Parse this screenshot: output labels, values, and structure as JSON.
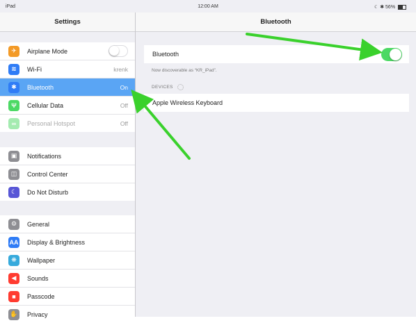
{
  "status_bar": {
    "device": "iPad",
    "time": "12:00 AM",
    "battery": "56%"
  },
  "master": {
    "title": "Settings",
    "group1": [
      {
        "label": "Airplane Mode",
        "icon": "airplane-icon",
        "color": "#f39a27",
        "control": "toggle-off"
      },
      {
        "label": "Wi-Fi",
        "icon": "wifi-icon",
        "color": "#2f7cf6",
        "value": "krenk"
      },
      {
        "label": "Bluetooth",
        "icon": "bluetooth-icon",
        "color": "#2f7cf6",
        "value": "On",
        "selected": true
      },
      {
        "label": "Cellular Data",
        "icon": "cellular-icon",
        "color": "#4cd964",
        "value": "Off"
      },
      {
        "label": "Personal Hotspot",
        "icon": "hotspot-icon",
        "color": "#4cd964",
        "value": "Off",
        "disabled": true
      }
    ],
    "group2": [
      {
        "label": "Notifications",
        "icon": "notifications-icon",
        "color": "#8e8e93"
      },
      {
        "label": "Control Center",
        "icon": "control-center-icon",
        "color": "#8e8e93"
      },
      {
        "label": "Do Not Disturb",
        "icon": "moon-icon",
        "color": "#5856d6"
      }
    ],
    "group3": [
      {
        "label": "General",
        "icon": "gear-icon",
        "color": "#8e8e93"
      },
      {
        "label": "Display & Brightness",
        "icon": "display-icon",
        "color": "#2f7cf6"
      },
      {
        "label": "Wallpaper",
        "icon": "wallpaper-icon",
        "color": "#36aadc"
      },
      {
        "label": "Sounds",
        "icon": "sound-icon",
        "color": "#ff3b30"
      },
      {
        "label": "Passcode",
        "icon": "lock-icon",
        "color": "#ff3b30"
      },
      {
        "label": "Privacy",
        "icon": "hand-icon",
        "color": "#8e8e93"
      }
    ]
  },
  "detail": {
    "title": "Bluetooth",
    "bluetooth_label": "Bluetooth",
    "bluetooth_on": true,
    "discoverable_note": "Now discoverable as “KR_iPad”.",
    "devices_header": "DEVICES",
    "devices": [
      {
        "name": "Apple Wireless Keyboard"
      }
    ]
  },
  "colors": {
    "accent": "#5aa5f4",
    "toggle_on": "#4cd964",
    "arrow": "#3ad12c"
  }
}
